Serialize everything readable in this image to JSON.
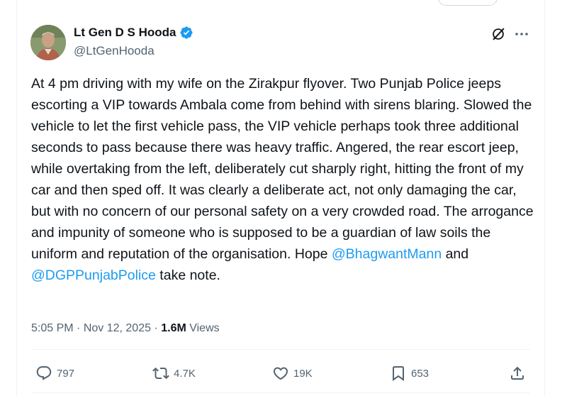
{
  "author": {
    "display_name": "Lt Gen D S Hooda",
    "handle": "@LtGenHooda",
    "verified": true
  },
  "tweet": {
    "text_parts": [
      "At 4 pm driving with my wife on the Zirakpur flyover. Two Punjab Police jeeps escorting a VIP towards Ambala come from behind with sirens blaring. Slowed the vehicle to let the first vehicle pass, the VIP vehicle perhaps took three additional seconds to pass because there was heavy traffic. Angered, the rear escort jeep, while overtaking from the left, deliberately cut sharply right, hitting the front of my car and then sped off. It was clearly a deliberate act, not only damaging the car, but with no concern of our personal safety on a very crowded road. The arrogance and impunity of someone who is supposed to be a guardian of law soils the uniform and reputation of the organisation. Hope ",
      " and ",
      " take note."
    ],
    "mentions": [
      "@BhagwantMann",
      "@DGPPunjabPolice"
    ]
  },
  "meta": {
    "time": "5:05 PM",
    "separator": " · ",
    "date": "Nov 12, 2025",
    "views_count": "1.6M",
    "views_label": " Views"
  },
  "actions": {
    "replies": "797",
    "reposts": "4.7K",
    "likes": "19K",
    "bookmarks": "653"
  },
  "icons": {
    "reply": "reply-icon",
    "repost": "repost-icon",
    "like": "like-icon",
    "bookmark": "bookmark-icon",
    "share": "share-icon",
    "grok": "grok-icon",
    "more": "more-icon",
    "verified": "verified-badge-icon"
  },
  "colors": {
    "accent": "#1d9bf0",
    "text": "#0f1419",
    "secondary": "#536471"
  }
}
